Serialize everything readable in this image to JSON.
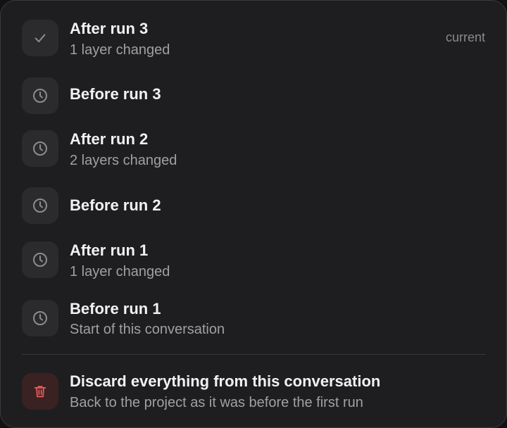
{
  "versions": [
    {
      "title": "After run 3",
      "subtitle": "1 layer changed",
      "icon": "checkmark-icon",
      "tag": "current"
    },
    {
      "title": "Before run 3",
      "subtitle": "",
      "icon": "clock-icon"
    },
    {
      "title": "After run 2",
      "subtitle": "2 layers changed",
      "icon": "clock-icon"
    },
    {
      "title": "Before run 2",
      "subtitle": "",
      "icon": "clock-icon"
    },
    {
      "title": "After run 1",
      "subtitle": "1 layer changed",
      "icon": "clock-icon"
    },
    {
      "title": "Before run 1",
      "subtitle": "Start of this conversation",
      "icon": "clock-icon"
    }
  ],
  "discard": {
    "title": "Discard everything from this conversation",
    "subtitle": "Back to the project as it was before the first run",
    "icon": "trash-icon"
  },
  "colors": {
    "panel_bg": "#1e1e20",
    "icon_bg": "#2b2b2e",
    "danger": "#e05a5a",
    "danger_bg": "#3a2222",
    "text_primary": "#f2f2f2",
    "text_secondary": "#a0a0a4"
  }
}
